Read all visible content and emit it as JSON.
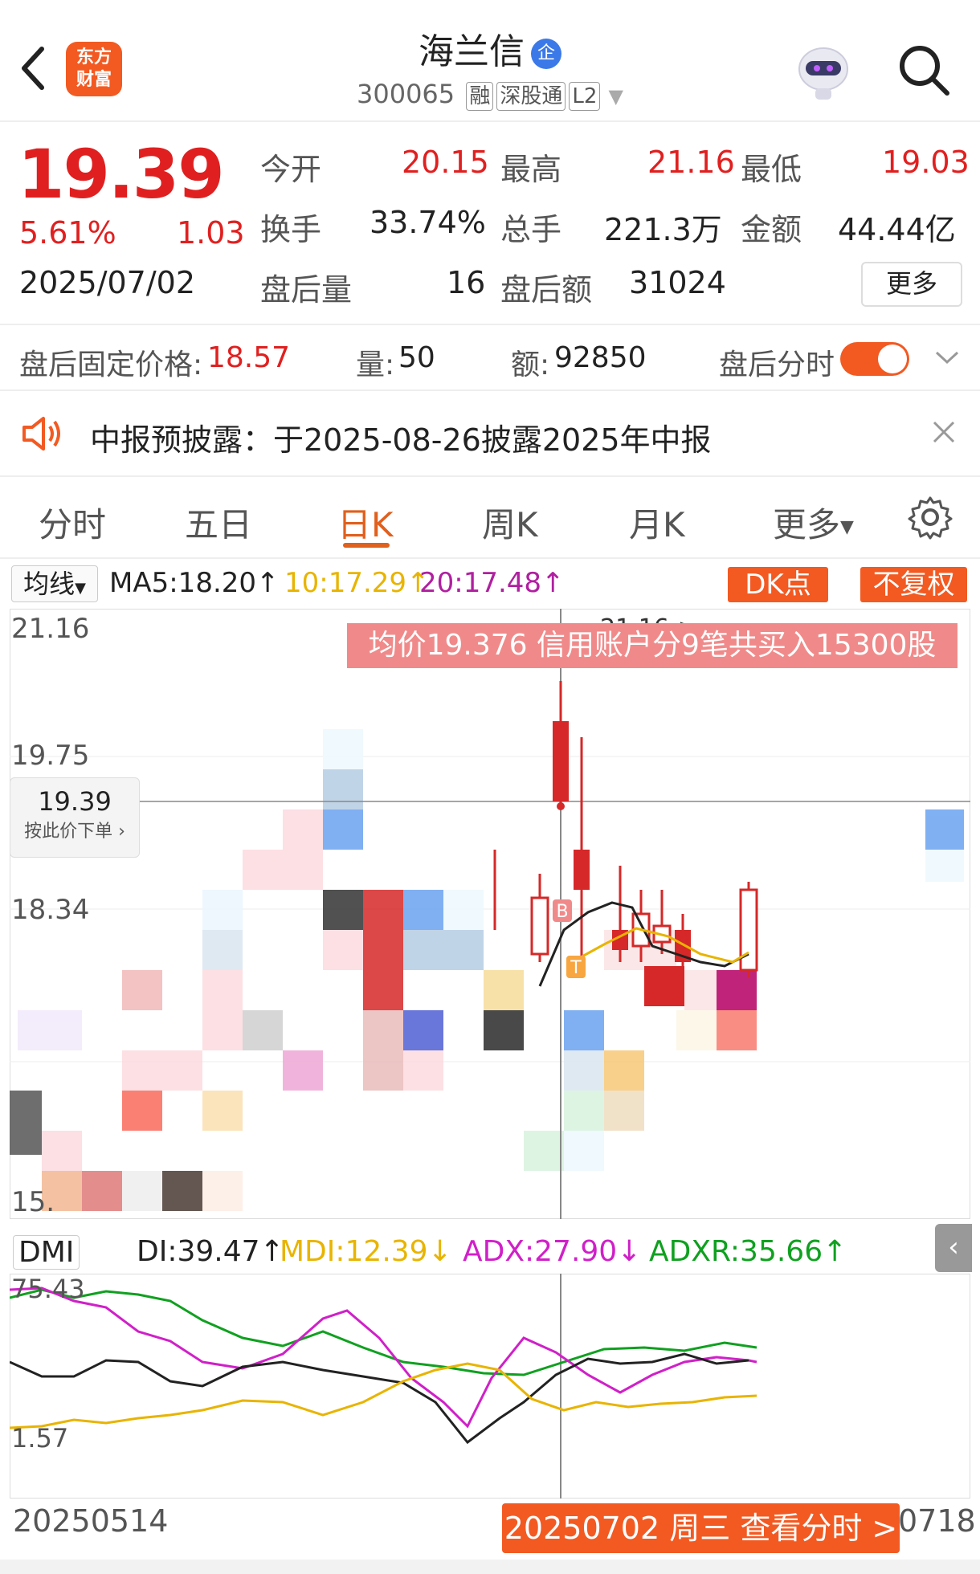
{
  "header": {
    "title": "海兰信",
    "enterprise_badge": "企",
    "code": "300065",
    "tags": [
      "融",
      "深股通",
      "L2"
    ],
    "logo_line1": "东方",
    "logo_line2": "财富"
  },
  "quote": {
    "price": "19.39",
    "change_pct": "5.61%",
    "change": "1.03",
    "date": "2025/07/02",
    "fields": [
      {
        "label": "今开",
        "value": "20.15"
      },
      {
        "label": "最高",
        "value": "21.16"
      },
      {
        "label": "最低",
        "value": "19.03"
      },
      {
        "label": "换手",
        "value": "33.74%"
      },
      {
        "label": "总手",
        "value": "221.3万"
      },
      {
        "label": "金额",
        "value": "44.44亿"
      },
      {
        "label": "盘后量",
        "value": "16"
      },
      {
        "label": "盘后额",
        "value": "31024"
      }
    ],
    "more_label": "更多"
  },
  "after_hours": {
    "fixed_price_label": "盘后固定价格:",
    "fixed_price": "18.57",
    "volume_label": "量:",
    "volume": "50",
    "amount_label": "额:",
    "amount": "92850",
    "toggle_label": "盘后分时",
    "toggle_on": true
  },
  "notice": {
    "text": "中报预披露：于2025-08-26披露2025年中报"
  },
  "tabs": [
    "分时",
    "五日",
    "日K",
    "周K",
    "月K",
    "更多"
  ],
  "active_tab": "日K",
  "ma_bar": {
    "dropdown": "均线",
    "ma5": "MA5:18.20",
    "ma10": "10:17.29",
    "ma20": "20:17.48",
    "dk_button": "DK点",
    "fq_button": "不复权"
  },
  "kline": {
    "y_labels": [
      "21.16",
      "19.75",
      "18.34",
      "15."
    ],
    "high_marker": "21.16->",
    "banner": "均价19.376  信用账户分9笔共买入15300股",
    "price_box": "19.39",
    "price_box_sub": "按此价下单",
    "b_marker": "B",
    "t_marker": "T"
  },
  "dmi": {
    "label": "DMI",
    "pdi": "DI:39.47",
    "mdi": "MDI:12.39",
    "adx": "ADX:27.90",
    "adxr": "ADXR:35.66",
    "y_top": "75.43",
    "y_bottom": "1.57",
    "colors": {
      "pdi": "#222222",
      "mdi": "#e8b400",
      "adx": "#d020c8",
      "adxr": "#10a020"
    }
  },
  "footer": {
    "start_date": "20250514",
    "end_date": "0718",
    "view_button": "20250702 周三 查看分时 >"
  },
  "colors": {
    "accent": "#f25a22",
    "up": "#e02020",
    "down": "#10a020"
  }
}
